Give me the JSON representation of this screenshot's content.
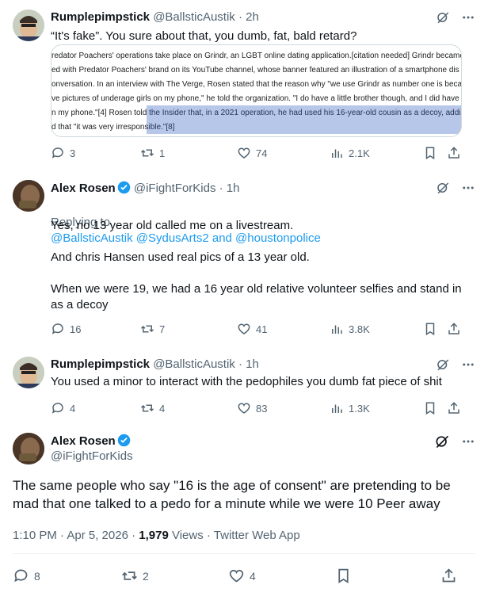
{
  "tweets": [
    {
      "name": "Rumplepimpstick",
      "handle": "@BallsticAustik",
      "time": "· 2h",
      "text": "“It's fake”. You sure about that, you dumb, fat, bald retard?",
      "embed_lines": [
        "redator Poachers' operations take place on Grindr, an LGBT online dating application.[citation needed] Grindr became",
        "ed with Predator Poachers' brand on its YouTube channel, whose banner featured an illustration of a smartphone dis",
        "onversation. In an interview with The Verge, Rosen stated that the reason why \"we use Grindr as number one is beca",
        "ve pictures of underage girls on my phone,\" he told the organization. \"I do have a little brother though, and I did have",
        "n my phone.\"[4] Rosen told the Insider that, in a 2021 operation, he had used his 16-year-old cousin as a decoy, addi",
        "d that \"it was very irresponsible.\"[8]"
      ],
      "replies": "3",
      "retweets": "1",
      "likes": "74",
      "views": "2.1K"
    },
    {
      "name": "Alex Rosen",
      "handle": "@iFightForKids",
      "time": "· 1h",
      "replying_label": "Replying to",
      "replying_to": "@BallsticAustik @SydusArts2 and @houstonpolice",
      "text": "Yes, no 13 year old called me on a livestream.\n\nAnd chris Hansen used real pics of a 13 year old.\n\nWhen we were 19, we had a 16 year old relative volunteer selfies and stand in as a decoy",
      "replies": "16",
      "retweets": "7",
      "likes": "41",
      "views": "3.8K"
    },
    {
      "name": "Rumplepimpstick",
      "handle": "@BallsticAustik",
      "time": "· 1h",
      "text": "You used a minor to interact with the pedophiles you dumb fat piece of shit",
      "replies": "4",
      "retweets": "4",
      "likes": "83",
      "views": "1.3K"
    }
  ],
  "main": {
    "name": "Alex Rosen",
    "handle": "@iFightForKids",
    "text": "The same people who say \"16 is the age of consent\" are pretending to be mad that one talked to a pedo for a minute while we were 10 Peer away",
    "time": "1:10 PM · Apr 5, 2026 · ",
    "views_count": "1,979",
    "views_label": " Views · Twitter Web App",
    "replies": "8",
    "retweets": "2",
    "likes": "4"
  },
  "colors": {
    "verified": "#1d9bf0",
    "muted": "#536471",
    "link": "#1d9bf0"
  }
}
